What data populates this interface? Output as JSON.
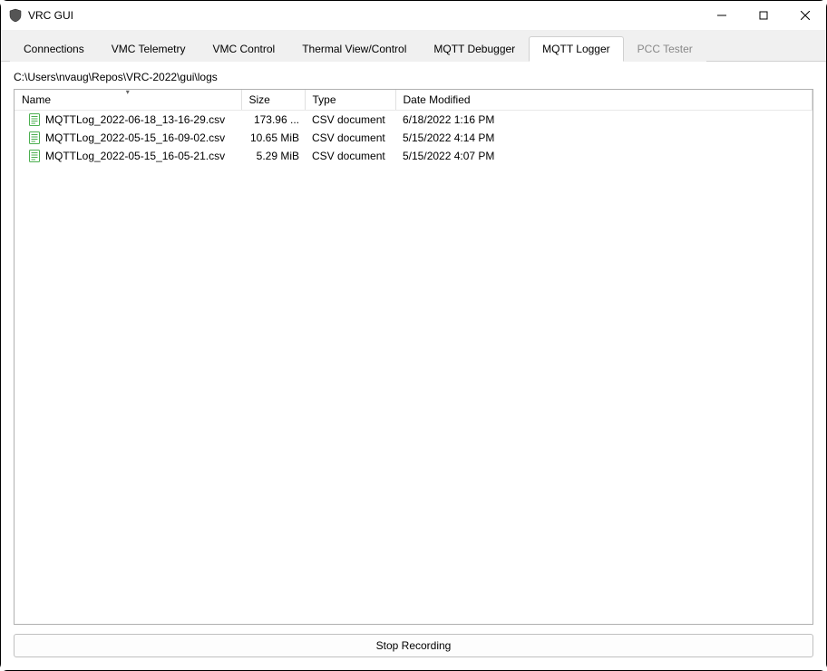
{
  "window": {
    "title": "VRC GUI"
  },
  "tabs": [
    {
      "label": "Connections",
      "active": false,
      "disabled": false
    },
    {
      "label": "VMC Telemetry",
      "active": false,
      "disabled": false
    },
    {
      "label": "VMC Control",
      "active": false,
      "disabled": false
    },
    {
      "label": "Thermal View/Control",
      "active": false,
      "disabled": false
    },
    {
      "label": "MQTT Debugger",
      "active": false,
      "disabled": false
    },
    {
      "label": "MQTT Logger",
      "active": true,
      "disabled": false
    },
    {
      "label": "PCC Tester",
      "active": false,
      "disabled": true
    }
  ],
  "path": "C:\\Users\\nvaug\\Repos\\VRC-2022\\gui\\logs",
  "columns": {
    "name": "Name",
    "size": "Size",
    "type": "Type",
    "date": "Date Modified"
  },
  "sort_indicator": "▾",
  "files": [
    {
      "name": "MQTTLog_2022-06-18_13-16-29.csv",
      "size": "173.96 ...",
      "type": "CSV document",
      "date": "6/18/2022 1:16 PM"
    },
    {
      "name": "MQTTLog_2022-05-15_16-09-02.csv",
      "size": "10.65 MiB",
      "type": "CSV document",
      "date": "5/15/2022 4:14 PM"
    },
    {
      "name": "MQTTLog_2022-05-15_16-05-21.csv",
      "size": "5.29 MiB",
      "type": "CSV document",
      "date": "5/15/2022 4:07 PM"
    }
  ],
  "button": {
    "stop": "Stop Recording"
  }
}
